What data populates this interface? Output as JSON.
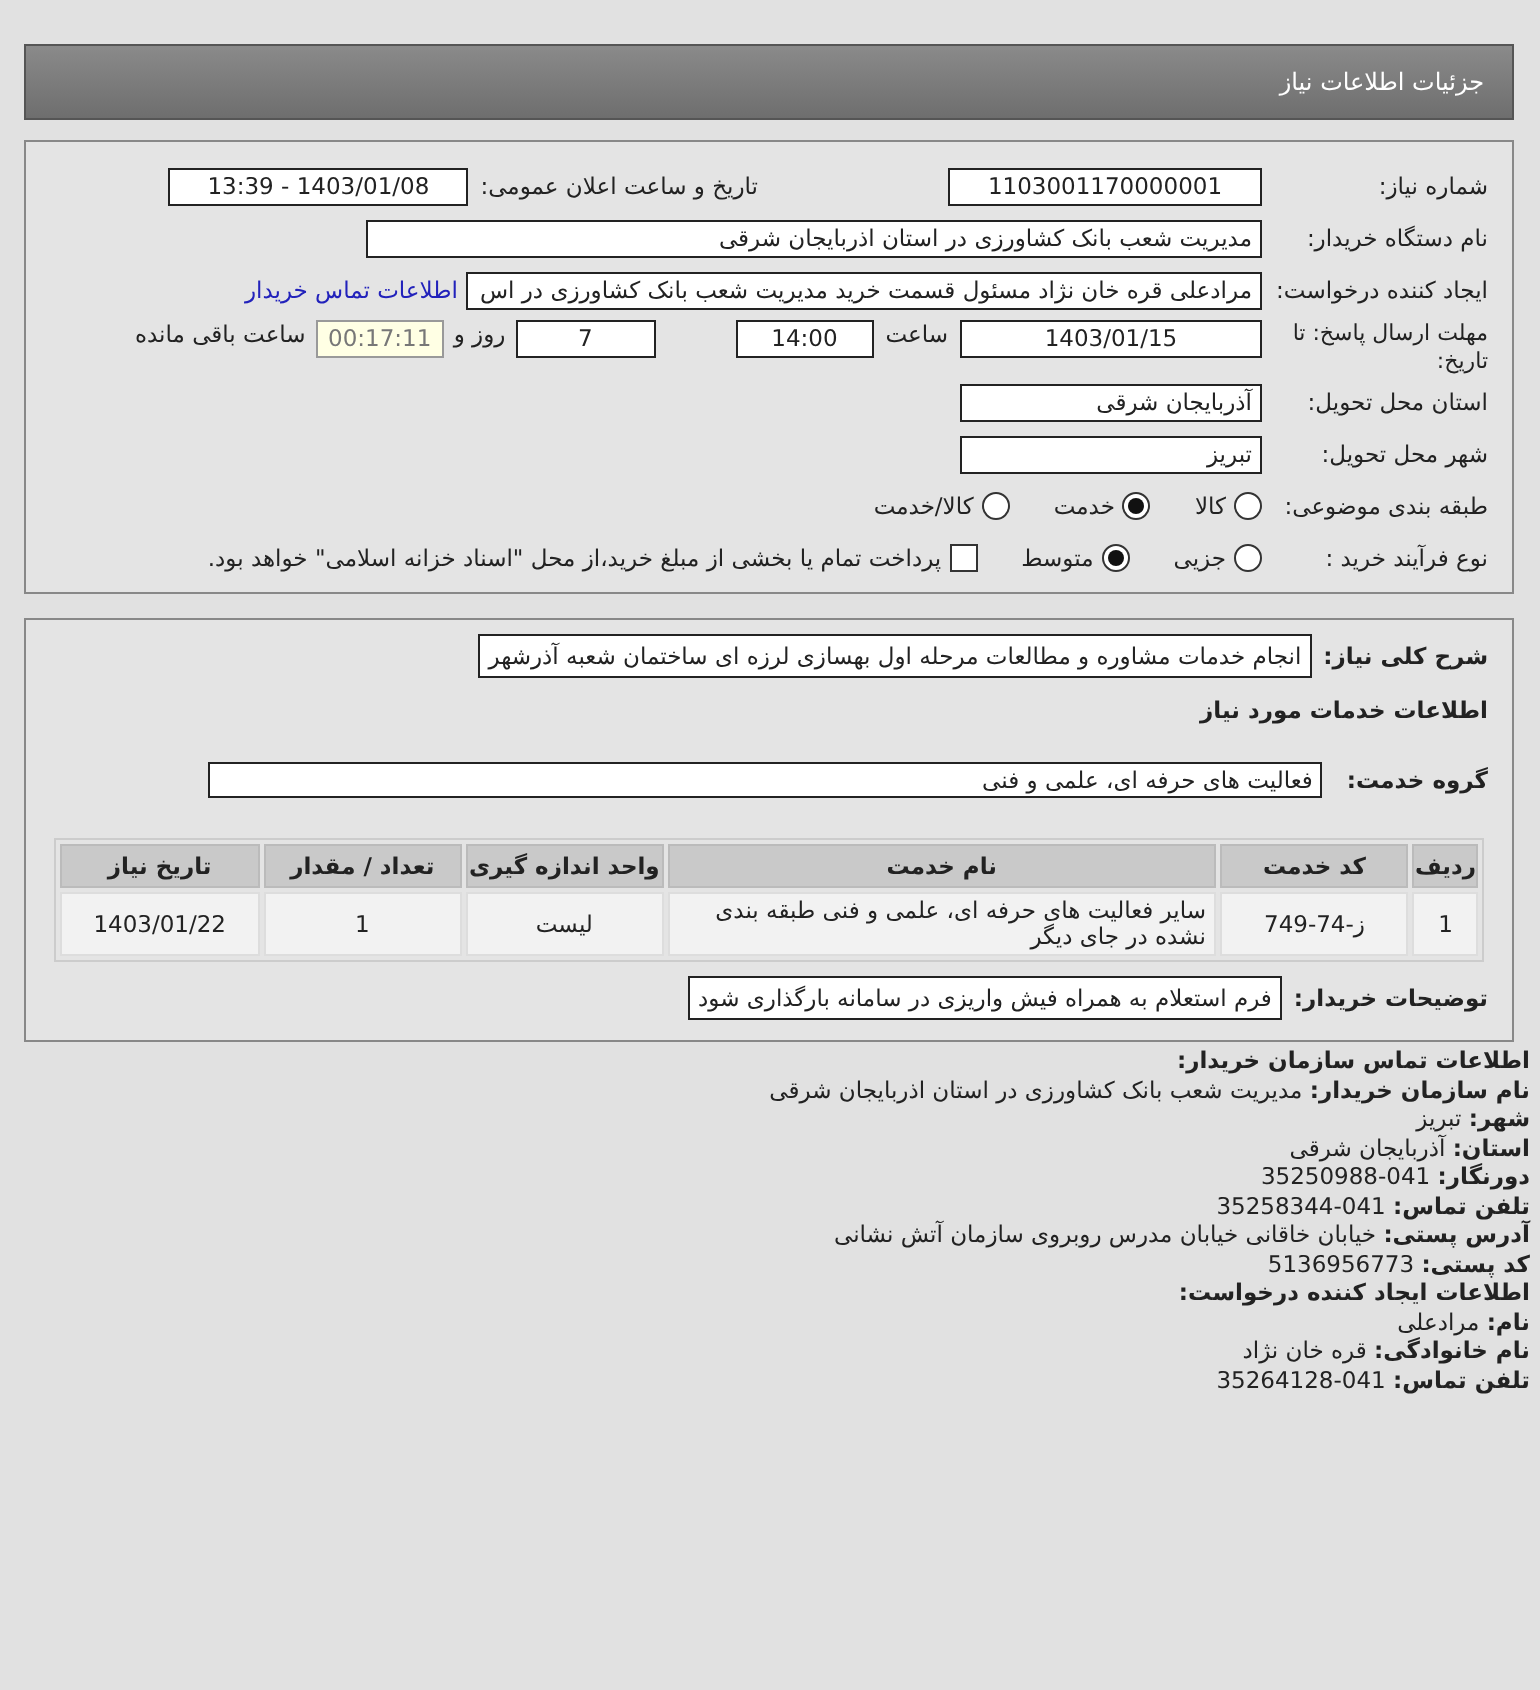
{
  "header": {
    "title": "جزئیات اطلاعات نیاز"
  },
  "need": {
    "need_number": {
      "label": "شماره نیاز:",
      "value": "1103001170000001"
    },
    "announce_date": {
      "label": "تاریخ و ساعت اعلان عمومی:",
      "value": "1403/01/08 - 13:39"
    },
    "buyer_org": {
      "label": "نام دستگاه خریدار:",
      "value": "مدیریت شعب بانک کشاورزی در استان اذربایجان شرقی"
    },
    "requester": {
      "label": "ایجاد کننده درخواست:",
      "value": "مرادعلی قره خان نژاد مسئول قسمت خرید مدیریت شعب بانک کشاورزی در اس",
      "link": "اطلاعات تماس خریدار"
    },
    "deadline": {
      "label": "مهلت ارسال پاسخ: تا تاریخ:",
      "date": "1403/01/15",
      "time_label": "ساعت",
      "time": "14:00",
      "days": "7",
      "days_label": "روز و",
      "remaining": "00:17:11",
      "remaining_label": "ساعت باقی مانده"
    },
    "province": {
      "label": "استان محل تحویل:",
      "value": "آذربایجان شرقی"
    },
    "city": {
      "label": "شهر محل تحویل:",
      "value": "تبریز"
    },
    "category": {
      "label": "طبقه بندی موضوعی:",
      "options": [
        {
          "label": "کالا",
          "selected": false
        },
        {
          "label": "خدمت",
          "selected": true
        },
        {
          "label": "کالا/خدمت",
          "selected": false
        }
      ]
    },
    "process": {
      "label": "نوع فرآیند خرید :",
      "options": [
        {
          "label": "جزیی",
          "selected": false
        },
        {
          "label": "متوسط",
          "selected": true
        }
      ],
      "payment": {
        "label": "پرداخت تمام یا بخشی از مبلغ خرید،از محل \"اسناد خزانه اسلامی\" خواهد بود.",
        "checked": false
      }
    }
  },
  "services": {
    "summary": {
      "label": "شرح کلی نیاز:",
      "value": "انجام خدمات مشاوره و مطالعات مرحله اول بهسازی لرزه ای ساختمان شعبه آذرشهر"
    },
    "heading": "اطلاعات خدمات مورد نیاز",
    "group": {
      "label": "گروه خدمت:",
      "value": "فعالیت های حرفه ای، علمی و فنی"
    },
    "table": {
      "columns": [
        "ردیف",
        "کد خدمت",
        "نام خدمت",
        "واحد اندازه گیری",
        "تعداد / مقدار",
        "تاریخ نیاز"
      ],
      "rows": [
        [
          "1",
          "ز-74-749",
          "سایر فعالیت های حرفه ای، علمی و فنی طبقه بندی نشده در جای دیگر",
          "لیست",
          "1",
          "1403/01/22"
        ]
      ]
    },
    "notes": {
      "label": "توضیحات خریدار:",
      "value": "فرم استعلام به همراه فیش واریزی در سامانه بارگذاری شود"
    }
  },
  "contact": [
    {
      "kind": "heading",
      "label": "اطلاعات تماس سازمان خریدار:"
    },
    {
      "kind": "field",
      "label": "نام سازمان خریدار:",
      "value": "مدیریت شعب بانک کشاورزی در استان اذربایجان شرقی"
    },
    {
      "kind": "field",
      "label": "شهر:",
      "value": "تبریز"
    },
    {
      "kind": "field",
      "label": "استان:",
      "value": "آذربایجان شرقی"
    },
    {
      "kind": "field",
      "label": "دورنگار:",
      "value": "041-35250988"
    },
    {
      "kind": "field",
      "label": "تلفن تماس:",
      "value": "041-35258344"
    },
    {
      "kind": "field",
      "label": "آدرس پستی:",
      "value": "خیابان خاقانی خیابان مدرس روبروی سازمان آتش نشانی"
    },
    {
      "kind": "field",
      "label": "کد پستی:",
      "value": "5136956773"
    },
    {
      "kind": "heading",
      "label": "اطلاعات ایجاد کننده درخواست:"
    },
    {
      "kind": "field",
      "label": "نام:",
      "value": "مرادعلی"
    },
    {
      "kind": "field",
      "label": "نام خانوادگی:",
      "value": "قره خان نژاد"
    },
    {
      "kind": "field",
      "label": "تلفن تماس:",
      "value": "041-35264128"
    }
  ]
}
